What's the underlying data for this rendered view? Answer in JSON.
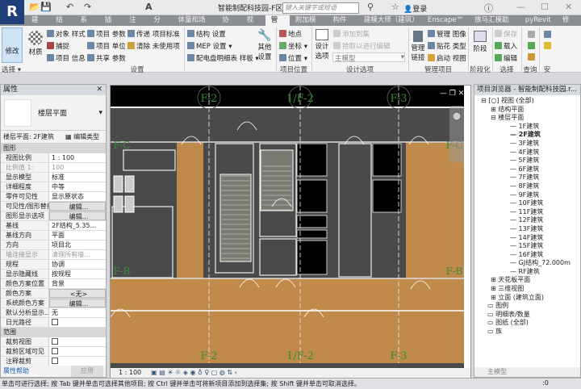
{
  "app": {
    "logo": "R",
    "title": "智能制配科技园-F区...",
    "search_placeholder": "键入关键字或短语",
    "login": "登录"
  },
  "tabs": [
    "建筑",
    "结构",
    "系统",
    "插入",
    "注释",
    "分析",
    "体量和场地",
    "协作",
    "视图",
    "管理",
    "附加模块",
    "构件坞",
    "建模大师（建筑）",
    "Enscape™",
    "族马汇模助手",
    "pyRevit",
    "修改"
  ],
  "active_tab": "管理",
  "ribbon": {
    "modify": "修改",
    "select": "选择 ▾",
    "material": "材质",
    "settings": [
      "对象 样式",
      "捕捉",
      "项目 信息",
      "项目 参数",
      "项目 单位",
      "共享 参数",
      "传递 项目标准",
      "清除 未使用项"
    ],
    "settings2": [
      "结构 设置",
      "MEP 设置 ▾",
      "配电盘明细表 样板 ▾"
    ],
    "other_settings": "其他设置",
    "settings_label": "设置",
    "location": [
      "地点",
      "坐标 ▾",
      "位置 ▾"
    ],
    "location_label": "项目位置",
    "design_options": "设计选项",
    "add_to_set": "添加到集",
    "pick_to_edit": "拾取以进行编辑",
    "main_model": "主模型",
    "design_options_label": "设计选项",
    "manage_links": "管理链接",
    "manage_images": "管理 图像",
    "decal_types": "贴花 类型",
    "startup_view": "启动 视图",
    "manage_project_label": "管理项目",
    "phases": "阶段",
    "phasing_label": "阶段化",
    "sel_save": "保存",
    "sel_load": "载入",
    "sel_edit": "编辑",
    "selection_label": "选择",
    "inquiry_label": "查询",
    "security_label": "安"
  },
  "properties": {
    "title": "属性",
    "type_name": "楼层平面",
    "instance": "楼层平面: 2F建筑",
    "edit_type": "编辑类型",
    "group_graphics": "图形",
    "rows": [
      {
        "k": "视图比例",
        "v": "1 : 100"
      },
      {
        "k": "比例值 1:",
        "v": "100",
        "disabled": true
      },
      {
        "k": "显示模型",
        "v": "标准"
      },
      {
        "k": "详细程度",
        "v": "中等"
      },
      {
        "k": "零件可见性",
        "v": "显示原状态"
      },
      {
        "k": "可见性/图形替换",
        "v": "编辑...",
        "button": true
      },
      {
        "k": "图形显示选项",
        "v": "编辑...",
        "button": true
      },
      {
        "k": "基线",
        "v": "2F结构_5.35..."
      },
      {
        "k": "基线方向",
        "v": "平面"
      },
      {
        "k": "方向",
        "v": "项目北"
      },
      {
        "k": "墙连接显示",
        "v": "清理所有墙...",
        "disabled": true
      },
      {
        "k": "规程",
        "v": "协调"
      },
      {
        "k": "显示隐藏线",
        "v": "按规程"
      },
      {
        "k": "颜色方案位置",
        "v": "背景"
      },
      {
        "k": "颜色方案",
        "v": "<无>",
        "button": true
      },
      {
        "k": "系统颜色方案",
        "v": "编辑...",
        "button": true
      },
      {
        "k": "默认分析显示...",
        "v": "无"
      },
      {
        "k": "日光路径",
        "v": "",
        "check": true
      }
    ],
    "group_extents": "范围",
    "rows2": [
      {
        "k": "裁剪视图",
        "v": ""
      },
      {
        "k": "裁剪区域可见",
        "v": ""
      },
      {
        "k": "注释裁剪",
        "v": ""
      }
    ],
    "help": "属性帮助",
    "apply": "应用"
  },
  "view": {
    "grid_labels": [
      "F-2",
      "1/F-2",
      "F-3"
    ],
    "row_labels": [
      "F-C",
      "F-B"
    ],
    "scale": "1 : 100",
    "colors": {
      "background": "#4a4a4a",
      "floor": "#c08a4a",
      "grid": "#3a8a3a"
    }
  },
  "browser": {
    "title": "项目浏览器 - 智能制配科技园.r...",
    "root": "[○] 视图 (全部)",
    "structural_plans": "结构平面",
    "floor_plans": "楼层平面",
    "levels": [
      "1F建筑",
      "2F建筑",
      "3F建筑",
      "4F建筑",
      "5F建筑",
      "6F建筑",
      "7F建筑",
      "8F建筑",
      "9F建筑",
      "10F建筑",
      "11F建筑",
      "12F建筑",
      "13F建筑",
      "14F建筑",
      "15F建筑",
      "16F建筑",
      "GJ结构_72.000m",
      "RF建筑"
    ],
    "active_level": "2F建筑",
    "others": [
      "天花板平面",
      "三维视图",
      "立面 (建筑立面)"
    ],
    "roots": [
      "图例",
      "明细表/数量",
      "图纸 (全部)",
      "族"
    ]
  },
  "status": {
    "text": "单击可进行选择; 按 Tab 键并单击可选择其他项目; 按 Ctrl 键并单击可将新项目添加到选择集; 按 Shift 键并单击可取消选择。",
    "model": "主模型",
    "count": ":0"
  }
}
